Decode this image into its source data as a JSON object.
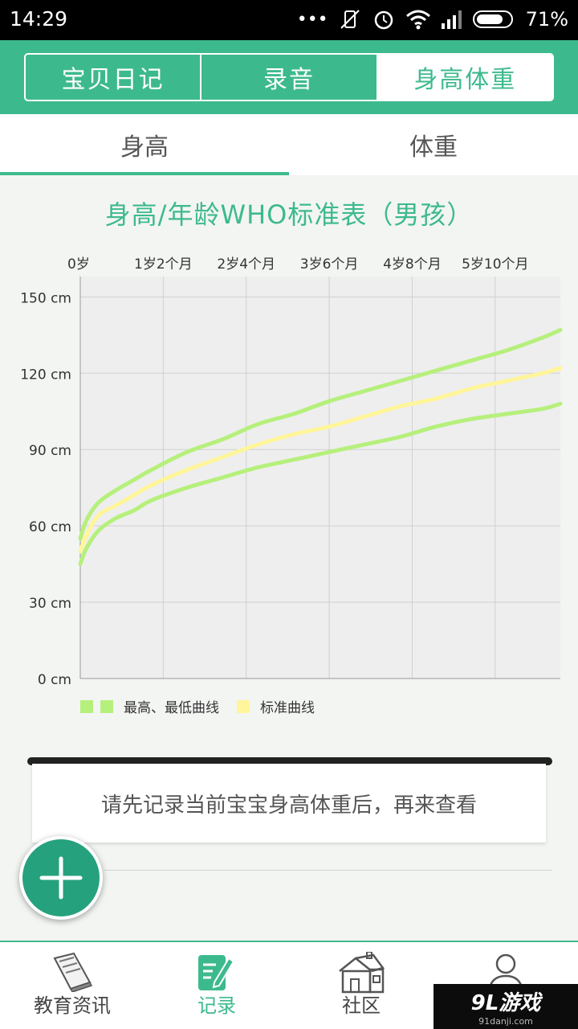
{
  "status_bar": {
    "time": "14:29",
    "battery": "71%",
    "dots": "•••"
  },
  "header": {
    "tabs": [
      {
        "label": "宝贝日记"
      },
      {
        "label": "录音"
      },
      {
        "label": "身高体重"
      }
    ]
  },
  "subtabs": [
    {
      "label": "身高"
    },
    {
      "label": "体重"
    }
  ],
  "chart_data": {
    "type": "line",
    "title": "身高/年龄WHO标准表（男孩）",
    "x_tick_labels": [
      "0岁",
      "1岁2个月",
      "2岁4个月",
      "3岁6个月",
      "4岁8个月",
      "5岁10个月"
    ],
    "x_ticks_months": [
      0,
      14,
      28,
      42,
      56,
      70
    ],
    "xlim_months": [
      0,
      81
    ],
    "y_tick_labels": [
      "150 cm",
      "120 cm",
      "90 cm",
      "60 cm",
      "30 cm",
      "0 cm"
    ],
    "y_ticks": [
      150,
      120,
      90,
      60,
      30,
      0
    ],
    "ylim": [
      0,
      158
    ],
    "grid": true,
    "legend_position": "bottom-left",
    "colors": {
      "high_low": "#b6f07c",
      "standard": "#fff59a",
      "plot_bg": "#eeeeee",
      "grid": "#d0d0d0"
    },
    "series": [
      {
        "name": "max",
        "color": "#b6f07c",
        "x": [
          0,
          1,
          3,
          6,
          9,
          12,
          18,
          24,
          30,
          36,
          42,
          48,
          54,
          60,
          66,
          72,
          78,
          81
        ],
        "y": [
          55,
          62,
          69,
          74,
          78,
          82,
          89,
          94,
          100,
          104,
          109,
          113,
          117,
          121,
          125,
          129,
          134,
          137
        ]
      },
      {
        "name": "median",
        "color": "#fff59a",
        "x": [
          0,
          1,
          3,
          6,
          9,
          12,
          18,
          24,
          30,
          36,
          42,
          48,
          54,
          60,
          66,
          72,
          78,
          81
        ],
        "y": [
          50,
          56,
          64,
          68,
          72,
          76,
          82,
          87,
          92,
          96,
          99,
          103,
          107,
          110,
          114,
          117,
          120,
          122
        ]
      },
      {
        "name": "min",
        "color": "#b6f07c",
        "x": [
          0,
          1,
          3,
          6,
          9,
          12,
          18,
          24,
          30,
          36,
          42,
          48,
          54,
          60,
          66,
          72,
          78,
          81
        ],
        "y": [
          45,
          51,
          58,
          63,
          66,
          70,
          75,
          79,
          83,
          86,
          89,
          92,
          95,
          99,
          102,
          104,
          106,
          108
        ]
      }
    ],
    "legend": [
      {
        "label": "最高、最低曲线"
      },
      {
        "label": "标准曲线"
      }
    ]
  },
  "note": {
    "text": "请先记录当前宝宝身高体重后，再来查看"
  },
  "fab": {
    "icon": "plus-icon"
  },
  "bottom_nav": [
    {
      "label": "教育资讯",
      "icon": "book-icon"
    },
    {
      "label": "记录",
      "icon": "edit-icon"
    },
    {
      "label": "社区",
      "icon": "house-icon"
    },
    {
      "label": "",
      "icon": "person-icon"
    }
  ],
  "watermark": {
    "main": "9L游戏",
    "sub": "91danji.com"
  }
}
